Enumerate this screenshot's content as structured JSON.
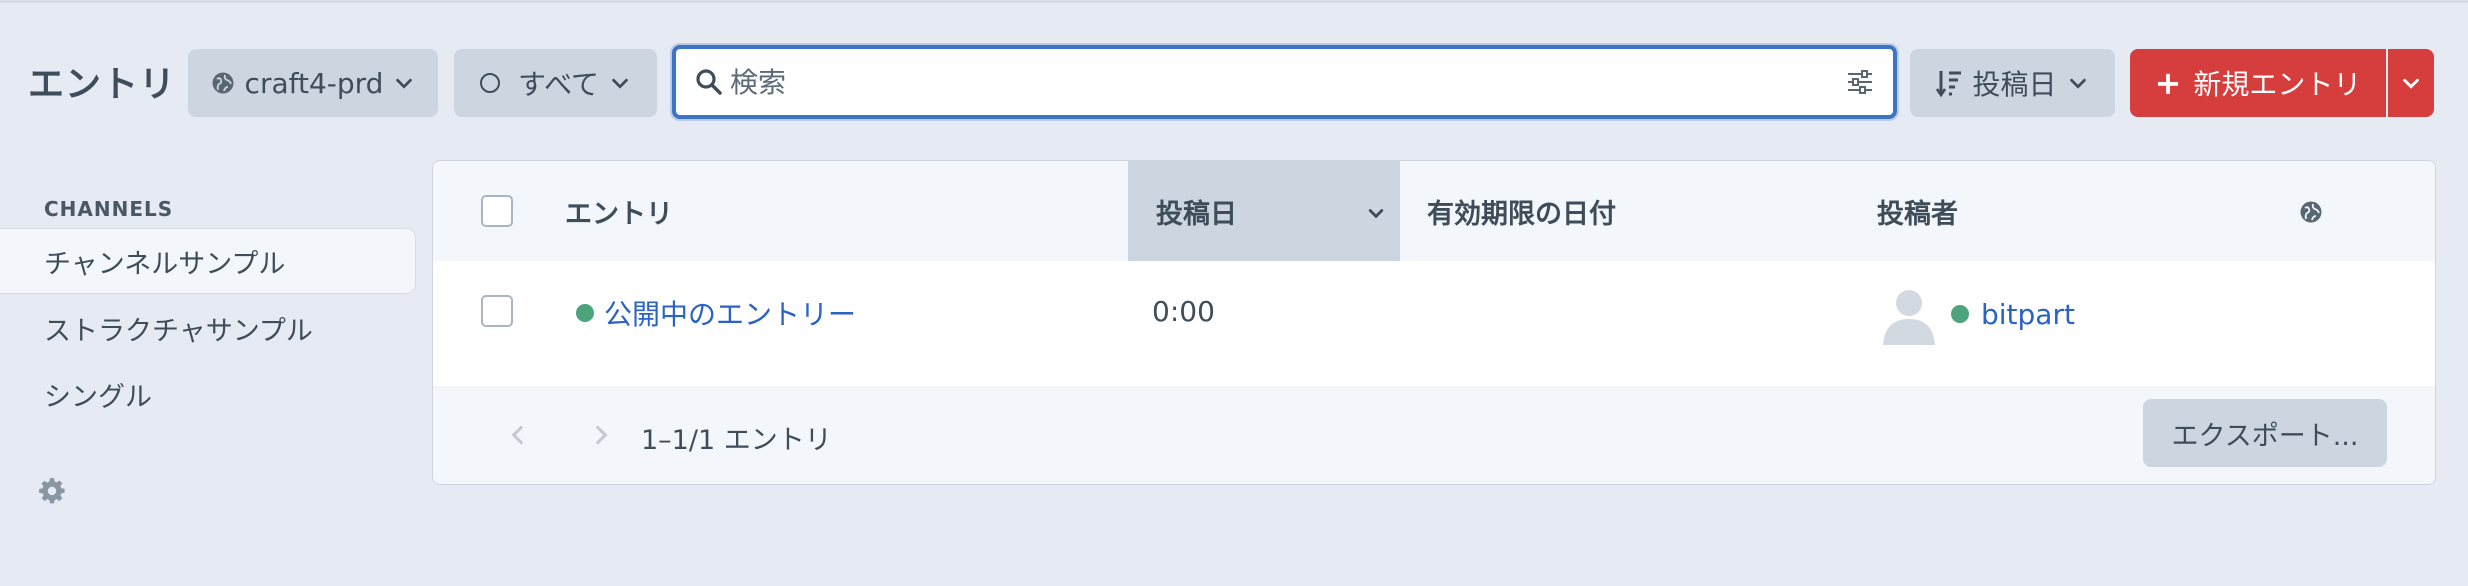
{
  "header": {
    "title": "エントリ",
    "site_label": "craft4-prd",
    "status_label": "すべて",
    "search_placeholder": "検索",
    "search_value": "",
    "sort_label": "投稿日",
    "new_entry_label": "新規エントリ"
  },
  "sidebar": {
    "heading": "CHANNELS",
    "items": [
      {
        "label": "チャンネルサンプル",
        "active": true
      },
      {
        "label": "ストラクチャサンプル",
        "active": false
      },
      {
        "label": "シングル",
        "active": false
      }
    ]
  },
  "table": {
    "columns": {
      "entry": "エントリ",
      "post_date": "投稿日",
      "expiry_date": "有効期限の日付",
      "author": "投稿者"
    },
    "sorted_column": "post_date",
    "rows": [
      {
        "title": "公開中のエントリー",
        "status": "live",
        "post_date": "0:00",
        "expiry_date": "",
        "author": "bitpart"
      }
    ],
    "pagination_text": "1–1/1 エントリ",
    "export_label": "エクスポート..."
  },
  "colors": {
    "accent": "#3d75c4",
    "primary_button": "#d63d3d",
    "status_live": "#4ea37f",
    "link": "#2b63c4"
  }
}
